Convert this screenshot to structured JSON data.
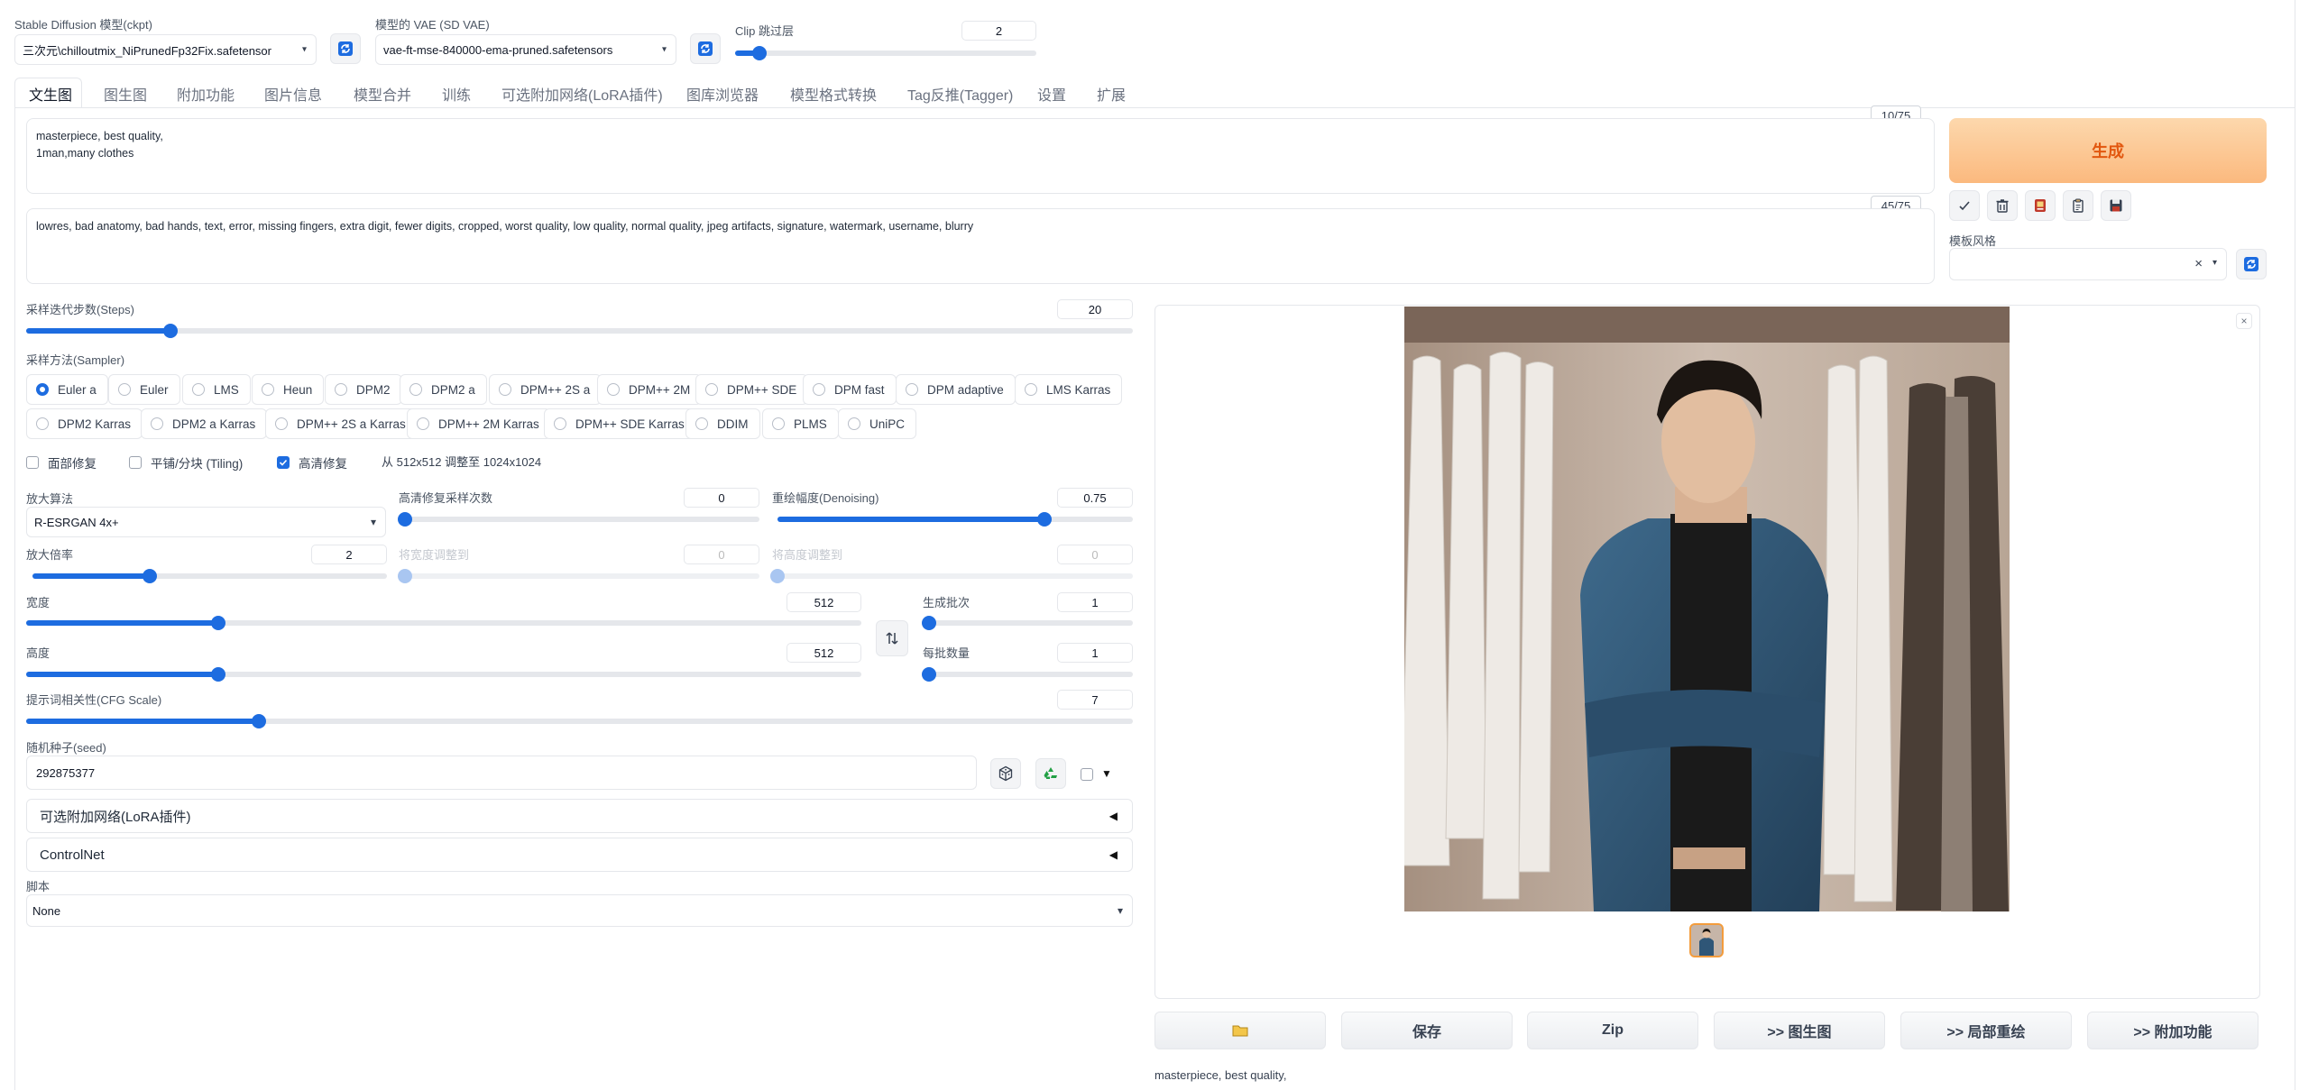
{
  "top": {
    "ckpt_label": "Stable Diffusion 模型(ckpt)",
    "ckpt_value": "三次元\\chilloutmix_NiPrunedFp32Fix.safetensor",
    "vae_label": "模型的 VAE (SD VAE)",
    "vae_value": "vae-ft-mse-840000-ema-pruned.safetensors",
    "clip_label": "Clip 跳过层",
    "clip_value": "2",
    "clip_fraction": 0.08
  },
  "tabs": [
    "文生图",
    "图生图",
    "附加功能",
    "图片信息",
    "模型合并",
    "训练",
    "可选附加网络(LoRA插件)",
    "图库浏览器",
    "模型格式转换",
    "Tag反推(Tagger)",
    "设置",
    "扩展"
  ],
  "prompt": {
    "positive": "masterpiece, best quality,\n1man,many clothes",
    "positive_counter": "10/75",
    "negative": "lowres, bad anatomy, bad hands, text, error, missing fingers, extra digit, fewer digits, cropped, worst quality, low quality, normal quality, jpeg artifacts, signature, watermark, username, blurry",
    "negative_counter": "45/75"
  },
  "side": {
    "generate_label": "生成",
    "style_label": "模板风格",
    "style_clear": "×",
    "icons": [
      "check-icon",
      "trash-icon",
      "card-icon",
      "clipboard-icon",
      "save-icon"
    ]
  },
  "steps": {
    "label": "采样迭代步数(Steps)",
    "value": "20",
    "fraction": 0.13
  },
  "sampler": {
    "label": "采样方法(Sampler)",
    "selected": "Euler a",
    "row1": [
      "Euler a",
      "Euler",
      "LMS",
      "Heun",
      "DPM2",
      "DPM2 a",
      "DPM++ 2S a",
      "DPM++ 2M",
      "DPM++ SDE",
      "DPM fast",
      "DPM adaptive",
      "LMS Karras"
    ],
    "row2": [
      "DPM2 Karras",
      "DPM2 a Karras",
      "DPM++ 2S a Karras",
      "DPM++ 2M Karras",
      "DPM++ SDE Karras",
      "DDIM",
      "PLMS",
      "UniPC"
    ]
  },
  "checks": {
    "face": "面部修复",
    "tiling": "平铺/分块 (Tiling)",
    "hires": "高清修复",
    "hires_checked": true,
    "hires_note": "从 512x512 调整至 1024x1024"
  },
  "hires": {
    "upscaler_label": "放大算法",
    "upscaler_value": "R-ESRGAN 4x+",
    "steps_label": "高清修复采样次数",
    "steps_value": "0",
    "steps_fraction": 0.0,
    "denoise_label": "重绘幅度(Denoising)",
    "denoise_value": "0.75",
    "denoise_fraction": 0.75,
    "scale_label": "放大倍率",
    "scale_value": "2",
    "scale_fraction": 0.33,
    "resize_w_label": "将宽度调整到",
    "resize_w_value": "0",
    "resize_h_label": "将高度调整到",
    "resize_h_value": "0"
  },
  "size": {
    "width_label": "宽度",
    "width_value": "512",
    "width_fraction": 0.23,
    "height_label": "高度",
    "height_value": "512",
    "height_fraction": 0.23,
    "batch_count_label": "生成批次",
    "batch_count_value": "1",
    "batch_size_label": "每批数量",
    "batch_size_value": "1"
  },
  "cfg": {
    "label": "提示词相关性(CFG Scale)",
    "value": "7",
    "fraction": 0.21
  },
  "seed": {
    "label": "随机种子(seed)",
    "value": "292875377"
  },
  "accordions": {
    "lora": "可选附加网络(LoRA插件)",
    "controlnet": "ControlNet"
  },
  "script": {
    "label": "脚本",
    "value": "None"
  },
  "output": {
    "buttons": [
      "保存",
      "Zip",
      ">> 图生图",
      ">> 局部重绘",
      ">> 附加功能"
    ],
    "caption": "masterpiece, best quality,"
  }
}
